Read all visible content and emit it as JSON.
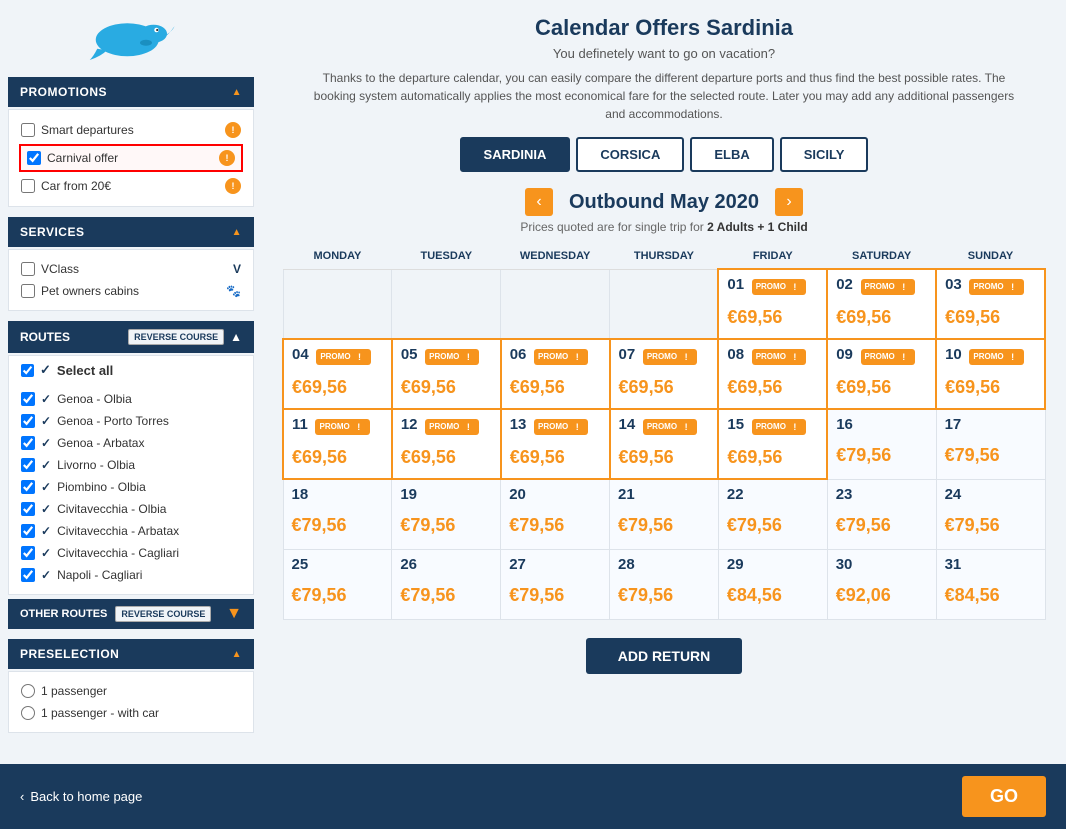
{
  "page": {
    "title": "Calendar Offers Sardinia",
    "subtitle": "You definetely want to go on vacation?",
    "description": "Thanks to the departure calendar, you can easily compare the different departure ports and thus find the best possible rates. The booking system automatically applies the most economical fare for the selected route. Later you may add any additional passengers and accommodations."
  },
  "destinations": [
    {
      "label": "SARDINIA",
      "active": true
    },
    {
      "label": "CORSICA",
      "active": false
    },
    {
      "label": "ELBA",
      "active": false
    },
    {
      "label": "SICILY",
      "active": false
    }
  ],
  "calendar": {
    "month_label": "Outbound May 2020",
    "price_info": "Prices quoted are for single trip for ",
    "passengers": "2 Adults + 1 Child"
  },
  "days_of_week": [
    "MONDAY",
    "TUESDAY",
    "WEDNESDAY",
    "THURSDAY",
    "FRIDAY",
    "SATURDAY",
    "SUNDAY"
  ],
  "weeks": [
    {
      "days": [
        {
          "num": "",
          "empty": true
        },
        {
          "num": "",
          "empty": true
        },
        {
          "num": "",
          "empty": true
        },
        {
          "num": "",
          "empty": true
        },
        {
          "num": "01",
          "promo": true,
          "price": "69,56"
        },
        {
          "num": "02",
          "promo": true,
          "price": "69,56"
        },
        {
          "num": "03",
          "promo": true,
          "price": "69,56"
        }
      ]
    },
    {
      "days": [
        {
          "num": "04",
          "promo": true,
          "price": "69,56"
        },
        {
          "num": "05",
          "promo": true,
          "price": "69,56"
        },
        {
          "num": "06",
          "promo": true,
          "price": "69,56"
        },
        {
          "num": "07",
          "promo": true,
          "price": "69,56"
        },
        {
          "num": "08",
          "promo": true,
          "price": "69,56"
        },
        {
          "num": "09",
          "promo": true,
          "price": "69,56"
        },
        {
          "num": "10",
          "promo": true,
          "price": "69,56"
        }
      ]
    },
    {
      "days": [
        {
          "num": "11",
          "promo": true,
          "price": "69,56"
        },
        {
          "num": "12",
          "promo": true,
          "price": "69,56"
        },
        {
          "num": "13",
          "promo": true,
          "price": "69,56"
        },
        {
          "num": "14",
          "promo": true,
          "price": "69,56"
        },
        {
          "num": "15",
          "promo": true,
          "price": "69,56"
        },
        {
          "num": "16",
          "promo": false,
          "price": "79,56"
        },
        {
          "num": "17",
          "promo": false,
          "price": "79,56"
        }
      ]
    },
    {
      "days": [
        {
          "num": "18",
          "promo": false,
          "price": "79,56"
        },
        {
          "num": "19",
          "promo": false,
          "price": "79,56"
        },
        {
          "num": "20",
          "promo": false,
          "price": "79,56"
        },
        {
          "num": "21",
          "promo": false,
          "price": "79,56"
        },
        {
          "num": "22",
          "promo": false,
          "price": "79,56"
        },
        {
          "num": "23",
          "promo": false,
          "price": "79,56"
        },
        {
          "num": "24",
          "promo": false,
          "price": "79,56"
        }
      ]
    },
    {
      "days": [
        {
          "num": "25",
          "promo": false,
          "price": "79,56"
        },
        {
          "num": "26",
          "promo": false,
          "price": "79,56"
        },
        {
          "num": "27",
          "promo": false,
          "price": "79,56"
        },
        {
          "num": "28",
          "promo": false,
          "price": "79,56"
        },
        {
          "num": "29",
          "promo": false,
          "price": "84,56"
        },
        {
          "num": "30",
          "promo": false,
          "price": "92,06"
        },
        {
          "num": "31",
          "promo": false,
          "price": "84,56"
        }
      ]
    }
  ],
  "sidebar": {
    "promotions_label": "PROMOTIONS",
    "promotions_items": [
      {
        "label": "Smart departures",
        "checked": false,
        "badge": true
      },
      {
        "label": "Carnival offer",
        "checked": true,
        "badge": true,
        "highlighted": true
      },
      {
        "label": "Car from 20€",
        "checked": false,
        "badge": true
      }
    ],
    "services_label": "SERVICES",
    "services_items": [
      {
        "label": "VClass",
        "checked": false,
        "icon": "V"
      },
      {
        "label": "Pet owners cabins",
        "checked": false,
        "icon": "🐾"
      }
    ],
    "routes_label": "ROUTES",
    "reverse_label": "REVERSE COURSE",
    "select_all": "Select all",
    "routes": [
      {
        "label": "Genoa - Olbia",
        "checked": true
      },
      {
        "label": "Genoa - Porto Torres",
        "checked": true
      },
      {
        "label": "Genoa - Arbatax",
        "checked": true
      },
      {
        "label": "Livorno - Olbia",
        "checked": true
      },
      {
        "label": "Piombino - Olbia",
        "checked": true
      },
      {
        "label": "Civitavecchia - Olbia",
        "checked": true
      },
      {
        "label": "Civitavecchia - Arbatax",
        "checked": true
      },
      {
        "label": "Civitavecchia - Cagliari",
        "checked": true
      },
      {
        "label": "Napoli - Cagliari",
        "checked": true
      }
    ],
    "other_routes_label": "OTHER ROUTES",
    "preselection_label": "PRESELECTION",
    "preselection_items": [
      {
        "label": "1 passenger",
        "checked": true
      },
      {
        "label": "1 passenger - with car",
        "checked": false
      }
    ]
  },
  "footer": {
    "back_label": "Back to home page",
    "go_label": "GO"
  },
  "add_return_label": "ADD RETURN"
}
